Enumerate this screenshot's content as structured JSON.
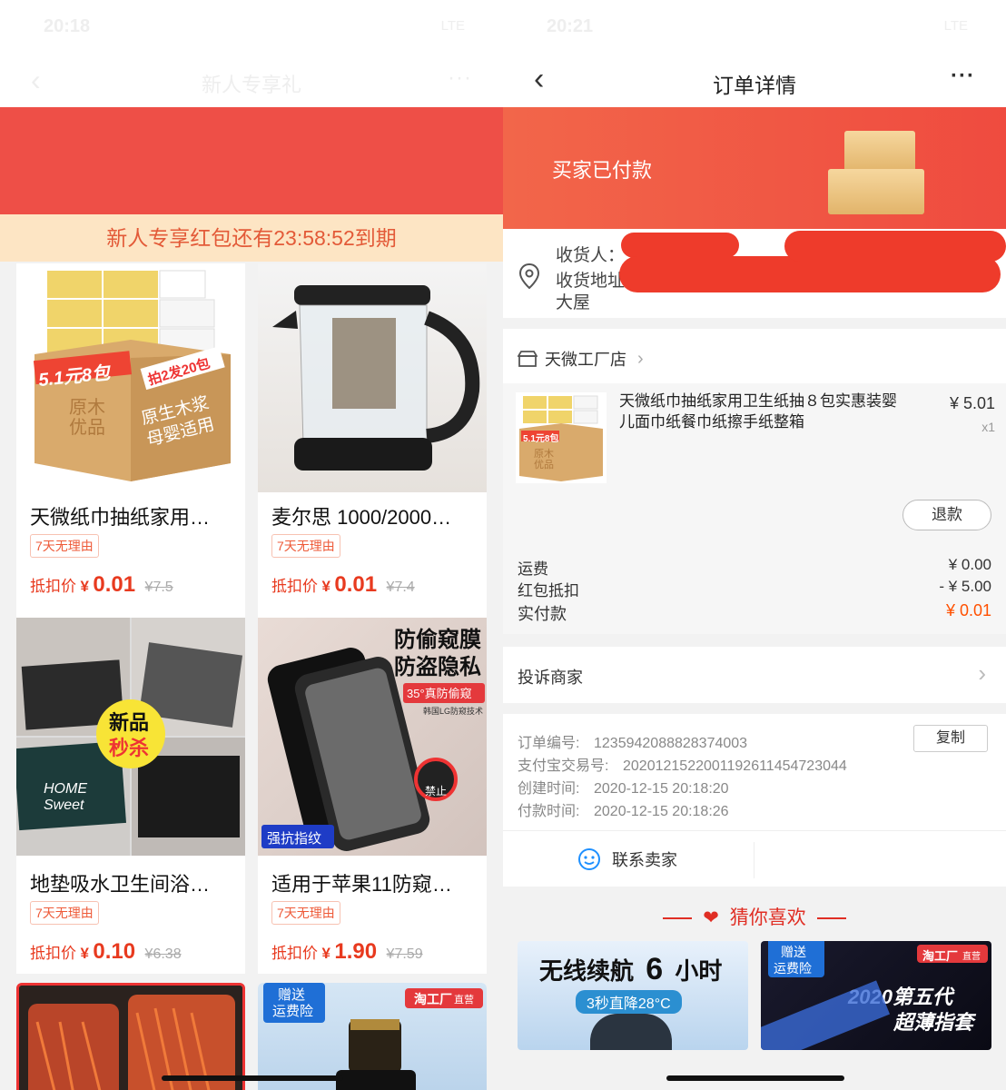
{
  "left": {
    "status_time": "20:18",
    "status_signal": "LTE",
    "nav_title": "新人专享礼",
    "expire_text": "新人专享红包还有23:58:52到期",
    "products": [
      {
        "name": "天微纸巾抽纸家用…",
        "tag": "7天无理由",
        "price_label": "抵扣价",
        "currency": "¥",
        "price": "0.01",
        "orig": "¥7.5",
        "img_text1": "5.1元8包",
        "img_text2": "拍2发20包",
        "img_text3": "原木优品",
        "img_text4": "原生木浆 母婴适用"
      },
      {
        "name": "麦尔思 1000/2000…",
        "tag": "7天无理由",
        "price_label": "抵扣价",
        "currency": "¥",
        "price": "0.01",
        "orig": "¥7.4"
      },
      {
        "name": "地垫吸水卫生间浴…",
        "tag": "7天无理由",
        "price_label": "抵扣价",
        "currency": "¥",
        "price": "0.10",
        "orig": "¥6.38",
        "img_text1": "新品",
        "img_text2": "秒杀",
        "img_text3": "HOME Sweet"
      },
      {
        "name": "适用于苹果11防窥…",
        "tag": "7天无理由",
        "price_label": "抵扣价",
        "currency": "¥",
        "price": "1.90",
        "orig": "¥7.59",
        "img_text1": "防偷窥膜",
        "img_text2": "防盗隐私",
        "img_text3": "35°真防偷窥",
        "img_text4": "韩国LG防窥技术",
        "img_text5": "强抗指纹",
        "img_text6": "禁止"
      },
      {
        "name": "",
        "tag": "",
        "price_label": "",
        "currency": "",
        "price": "",
        "orig": ""
      },
      {
        "name": "",
        "tag": "",
        "price_label": "",
        "currency": "",
        "price": "",
        "orig": "",
        "img_text1": "赠送",
        "img_text2": "运费险",
        "img_text3": "淘工厂",
        "img_text4": "直营"
      }
    ]
  },
  "right": {
    "status_time": "20:21",
    "status_signal": "LTE",
    "nav_title": "订单详情",
    "order_status": "买家已付款",
    "receiver_label": "收货人：",
    "address_label": "收货地址",
    "address_tail": "大屋",
    "shop_name": "天微工厂店",
    "item": {
      "name": "天微纸巾抽纸家用卫生纸抽８包实惠装婴儿面巾纸餐巾纸擦手纸整箱",
      "price": "¥ 5.01",
      "qty": "x1",
      "thumb_text1": "5.1元8包",
      "thumb_text2": "原木优品",
      "refund_label": "退款"
    },
    "fees": [
      {
        "label": "运费",
        "value": "¥ 0.00"
      },
      {
        "label": "红包抵扣",
        "value": "- ¥ 5.00"
      },
      {
        "label": "实付款",
        "value": "¥ 0.01"
      }
    ],
    "complain_label": "投诉商家",
    "order_info": {
      "copy_label": "复制",
      "rows": [
        {
          "k": "订单编号:",
          "v": "1235942088828374003"
        },
        {
          "k": "支付宝交易号:",
          "v": "2020121522001192611454723044"
        },
        {
          "k": "创建时间:",
          "v": "2020-12-15 20:18:20"
        },
        {
          "k": "付款时间:",
          "v": "2020-12-15 20:18:26"
        }
      ]
    },
    "contact_label": "联系卖家",
    "guess_title": "猜你喜欢",
    "guess_cards": [
      {
        "t1": "无线续航",
        "t2": "6",
        "t3": "小时",
        "t4": "3秒直降28°C"
      },
      {
        "t1": "赠送",
        "t2": "运费险",
        "t3": "淘工厂",
        "t4": "直营",
        "t5": "2020第五代",
        "t6": "超薄指套"
      }
    ]
  },
  "colors": {
    "brand_red": "#ee4f47",
    "price_red": "#e83a1f",
    "paid_orange": "#ff5000",
    "expire_bg": "#fde5c4"
  }
}
